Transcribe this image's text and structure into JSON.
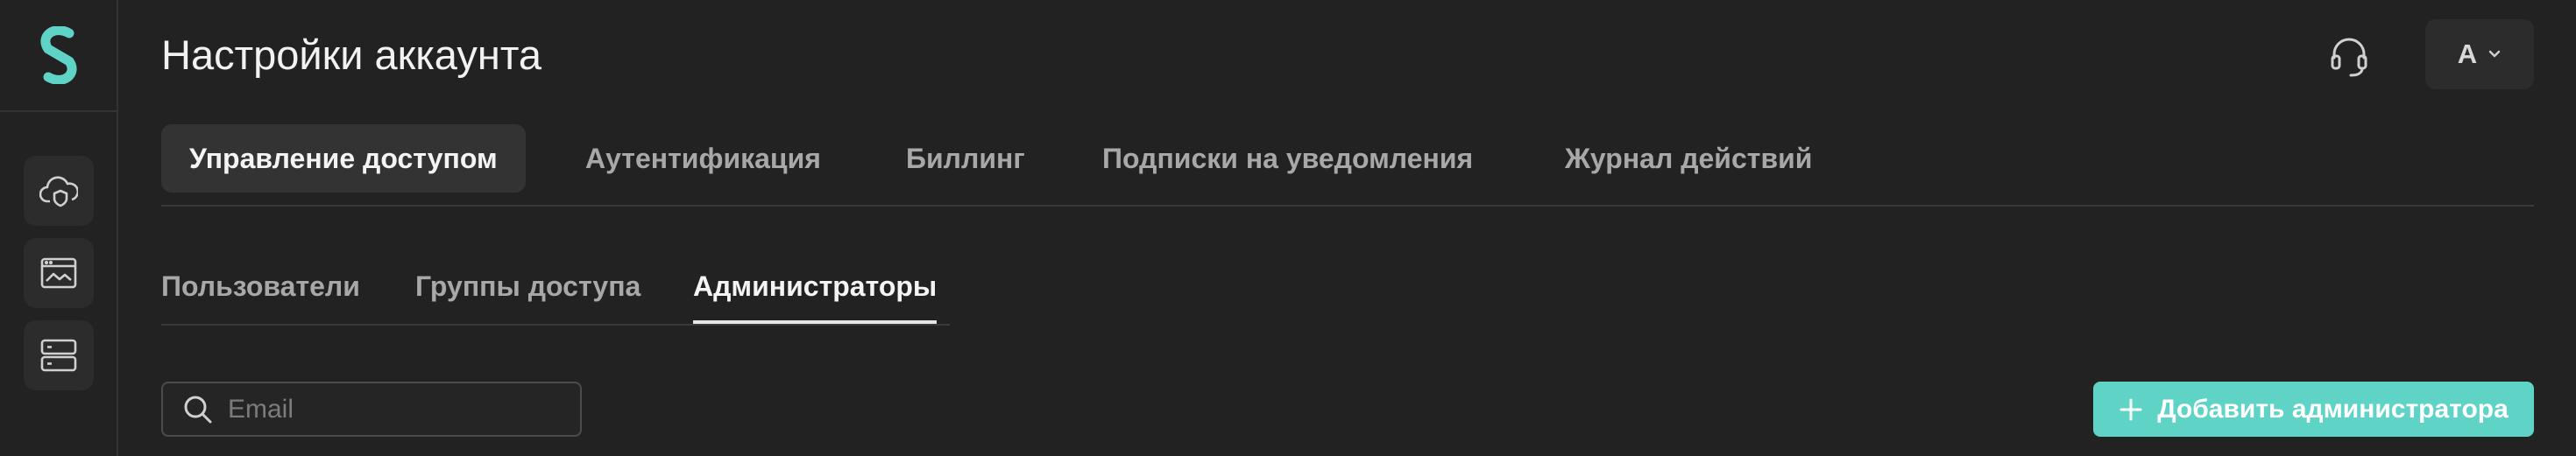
{
  "header": {
    "title": "Настройки аккаунта",
    "user_initial": "А"
  },
  "sidebar": {
    "items": [
      {
        "icon": "cloud-shield-icon"
      },
      {
        "icon": "dashboard-image-icon"
      },
      {
        "icon": "server-icon"
      }
    ]
  },
  "main_tabs": [
    {
      "label": "Управление доступом",
      "active": true
    },
    {
      "label": "Аутентификация",
      "active": false
    },
    {
      "label": "Биллинг",
      "active": false
    },
    {
      "label": "Подписки на уведомления",
      "active": false
    },
    {
      "label": "Журнал действий",
      "active": false
    }
  ],
  "sub_tabs": [
    {
      "label": "Пользователи",
      "active": false
    },
    {
      "label": "Группы доступа",
      "active": false
    },
    {
      "label": "Администраторы",
      "active": true
    }
  ],
  "search": {
    "placeholder": "Email",
    "value": ""
  },
  "actions": {
    "add_admin_label": "Добавить администратора"
  },
  "colors": {
    "background": "#222222",
    "accent": "#5fd3c6",
    "logo": "#5fd3c6"
  }
}
